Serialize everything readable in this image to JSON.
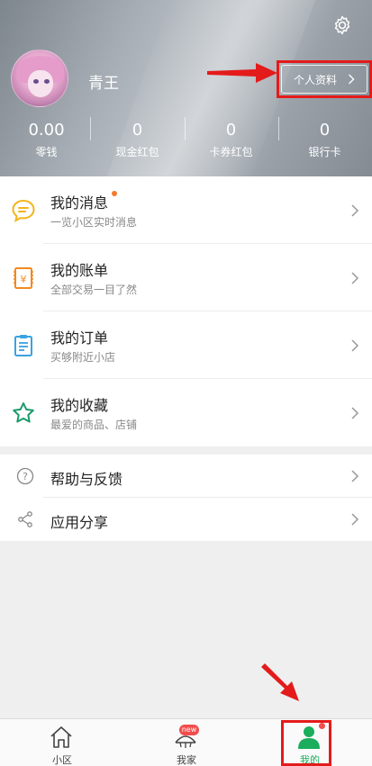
{
  "header": {
    "username": "青王",
    "profile_button": "个人资料",
    "stats": [
      {
        "value": "0.00",
        "label": "零钱"
      },
      {
        "value": "0",
        "label": "现金红包"
      },
      {
        "value": "0",
        "label": "卡券红包"
      },
      {
        "value": "0",
        "label": "银行卡"
      }
    ]
  },
  "menu": [
    {
      "title": "我的消息",
      "subtitle": "一览小区实时消息",
      "icon": "message-icon",
      "badge": "dot"
    },
    {
      "title": "我的账单",
      "subtitle": "全部交易一目了然",
      "icon": "bill-icon"
    },
    {
      "title": "我的订单",
      "subtitle": "买够附近小店",
      "icon": "order-icon"
    },
    {
      "title": "我的收藏",
      "subtitle": "最爱的商品、店铺",
      "icon": "star-icon"
    }
  ],
  "menu2": [
    {
      "title": "帮助与反馈",
      "icon": "help-icon"
    },
    {
      "title": "应用分享",
      "icon": "share-icon"
    }
  ],
  "tabbar": [
    {
      "label": "小区",
      "icon": "home-icon"
    },
    {
      "label": "我家",
      "icon": "my-home-icon",
      "badge": "new"
    },
    {
      "label": "我的",
      "icon": "person-icon",
      "active": true
    }
  ],
  "colors": {
    "accent": "#1aad5c",
    "annotation": "#e41b1b",
    "badge": "#f24d4d"
  }
}
